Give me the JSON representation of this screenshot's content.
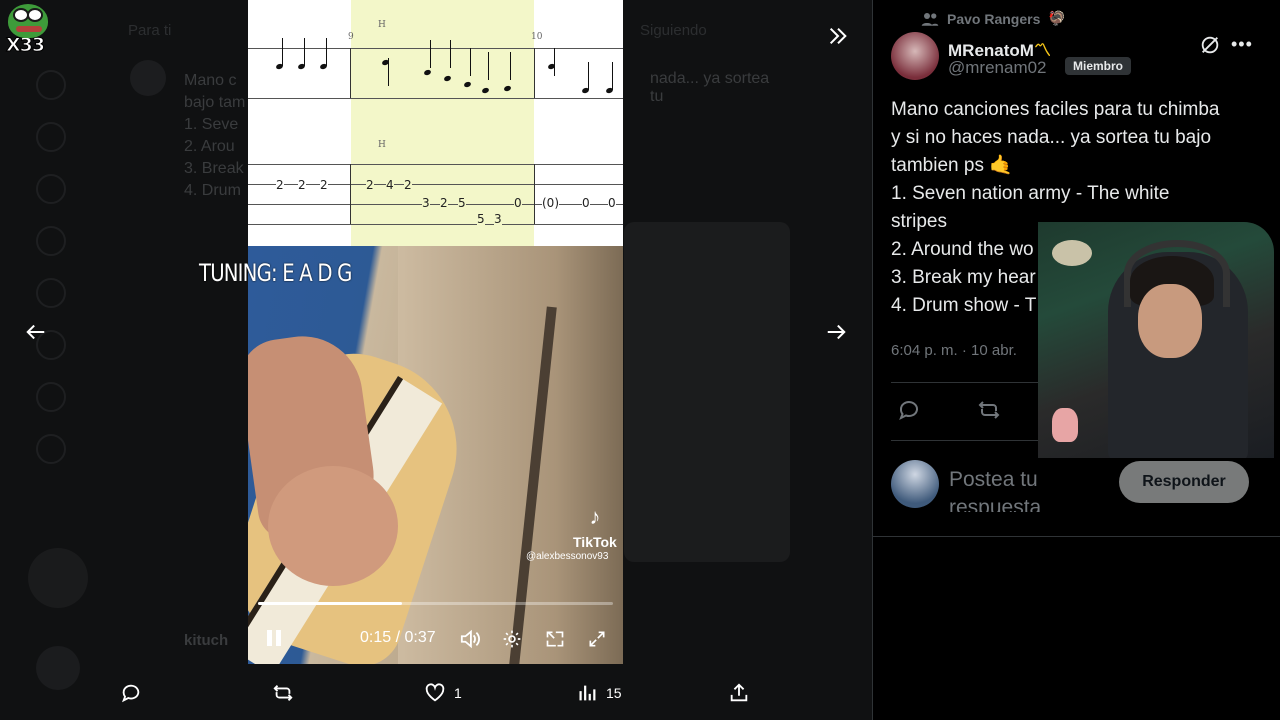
{
  "overlay": {
    "tag": "X33"
  },
  "background": {
    "tabs": [
      "Para ti",
      "Siguiendo"
    ],
    "tweet_text": "Mano c\nbajo tam\n1. Seve\n2. Arou\n3. Break\n4. Drum",
    "tweet_text_right": "nada... ya sortea tu",
    "username": "kituch"
  },
  "video": {
    "tuning_text": "TUNING: E A D G",
    "tiktok_label": "TikTok",
    "tiktok_handle": "@alexbessonov93",
    "current_time": "0:15",
    "duration": "0:37",
    "time_separator": " / ",
    "progress": 0.405,
    "tab_numbers": {
      "m1": [
        "2",
        "2",
        "2"
      ],
      "m2": [
        "2",
        "4",
        "2",
        "5",
        "3",
        "2",
        "5",
        "3",
        "0"
      ],
      "m3": [
        "(0)",
        "0",
        "0"
      ]
    },
    "measure_numbers": [
      "9",
      "10"
    ],
    "hammer_marks": [
      "H",
      "H"
    ]
  },
  "actions": {
    "like_count": "1",
    "views_count": "15"
  },
  "tweet": {
    "community": "Pavo Rangers",
    "display_name": "MRenatoM",
    "handle": "@mrenam02",
    "badge": "Miembro",
    "lines": [
      "Mano canciones faciles para tu chimba",
      "y si no haces nada... ya sortea tu bajo",
      "tambien ps 🤙",
      "1. Seven nation army - The white",
      "stripes",
      "2. Around the wo",
      "3. Break my hear",
      "4. Drum show - T"
    ],
    "timestamp": "6:04 p. m. · 10 abr."
  },
  "reply": {
    "placeholder_line1": "Postea tu",
    "placeholder_line2": "respuesta",
    "button": "Responder"
  },
  "colors": {
    "highlight": "#f3f7c9",
    "muted_text": "#71767b",
    "button_bg": "#787a7a"
  }
}
